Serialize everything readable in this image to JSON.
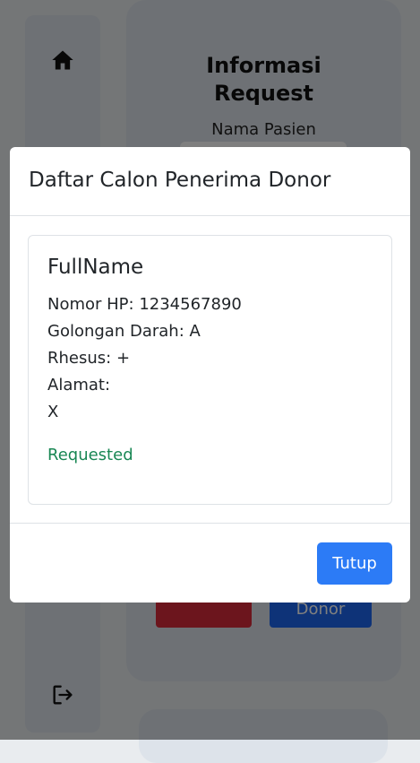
{
  "background": {
    "sidebar": {
      "home_icon": "home-icon",
      "logout_icon": "logout-icon"
    },
    "request_card": {
      "title_line1": "Informasi",
      "title_line2": "Request",
      "patient_label": "Nama Pasien",
      "donor_button_label": "Donor"
    }
  },
  "modal": {
    "title": "Daftar Calon Penerima Donor",
    "candidates": [
      {
        "full_name": "FullName",
        "phone": "Nomor HP: 1234567890",
        "blood_type": "Golongan Darah: A",
        "rhesus": "Rhesus: +",
        "address_label": "Alamat:",
        "address_value": "X",
        "status": "Requested"
      }
    ],
    "close_label": "Tutup"
  },
  "colors": {
    "primary": "#2c7bf6",
    "danger": "#d92a3a",
    "status_success": "#198754"
  }
}
